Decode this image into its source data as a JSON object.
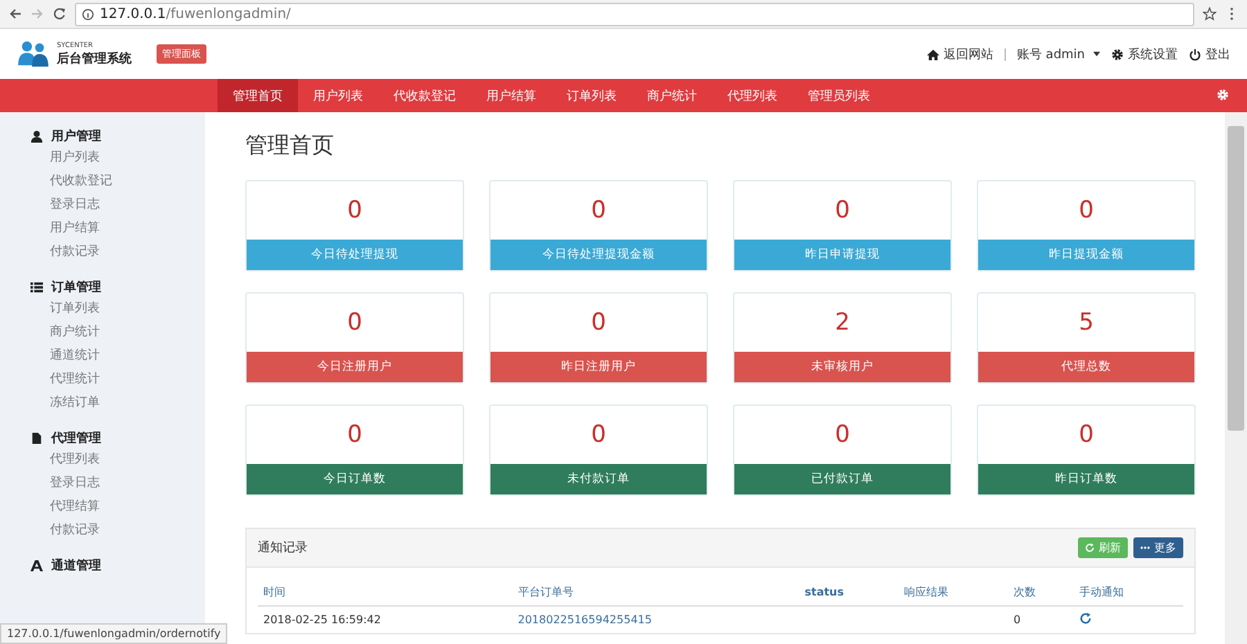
{
  "browser": {
    "url_host": "127.0.0.1",
    "url_path": "/fuwenlongadmin/"
  },
  "header": {
    "logo_small": "SYCENTER",
    "logo_title": "后台管理系统",
    "badge": "管理面板",
    "links": [
      {
        "kind": "home",
        "label": "返回网站"
      },
      {
        "kind": "account",
        "label": "账号 admin"
      },
      {
        "kind": "settings",
        "label": "系统设置"
      },
      {
        "kind": "logout",
        "label": "登出"
      }
    ]
  },
  "nav": [
    {
      "label": "管理首页",
      "selected": true
    },
    {
      "label": "用户列表",
      "selected": false
    },
    {
      "label": "代收款登记",
      "selected": false
    },
    {
      "label": "用户结算",
      "selected": false
    },
    {
      "label": "订单列表",
      "selected": false
    },
    {
      "label": "商户统计",
      "selected": false
    },
    {
      "label": "代理列表",
      "selected": false
    },
    {
      "label": "管理员列表",
      "selected": false
    }
  ],
  "sidebar": [
    {
      "kind": "user",
      "title": "用户管理",
      "items": [
        "用户列表",
        "代收款登记",
        "登录日志",
        "用户结算",
        "付款记录"
      ]
    },
    {
      "kind": "list",
      "title": "订单管理",
      "items": [
        "订单列表",
        "商户统计",
        "通道统计",
        "代理统计",
        "冻结订单"
      ]
    },
    {
      "kind": "file",
      "title": "代理管理",
      "items": [
        "代理列表",
        "登录日志",
        "代理结算",
        "付款记录"
      ]
    },
    {
      "kind": "font",
      "title": "通道管理"
    }
  ],
  "page_title": "管理首页",
  "stats": [
    {
      "value": "0",
      "label": "今日待处理提现",
      "kind": "info"
    },
    {
      "value": "0",
      "label": "今日待处理提现金额",
      "kind": "info"
    },
    {
      "value": "0",
      "label": "昨日申请提现",
      "kind": "info"
    },
    {
      "value": "0",
      "label": "昨日提现金额",
      "kind": "info"
    },
    {
      "value": "0",
      "label": "今日注册用户",
      "kind": "danger"
    },
    {
      "value": "0",
      "label": "昨日注册用户",
      "kind": "danger"
    },
    {
      "value": "2",
      "label": "未审核用户",
      "kind": "danger"
    },
    {
      "value": "5",
      "label": "代理总数",
      "kind": "danger"
    },
    {
      "value": "0",
      "label": "今日订单数",
      "kind": "success"
    },
    {
      "value": "0",
      "label": "未付款订单",
      "kind": "success"
    },
    {
      "value": "0",
      "label": "已付款订单",
      "kind": "success"
    },
    {
      "value": "0",
      "label": "昨日订单数",
      "kind": "success"
    }
  ],
  "panel": {
    "title": "通知记录",
    "refresh": "刷新",
    "more": "更多",
    "columns": [
      "时间",
      "平台订单号",
      "status",
      "响应结果",
      "次数",
      "手动通知"
    ],
    "rows": [
      {
        "time": "2018-02-25 16:59:42",
        "order": "2018022516594255415",
        "count": "0"
      }
    ]
  },
  "status_url": "127.0.0.1/fuwenlongadmin/ordernotify"
}
